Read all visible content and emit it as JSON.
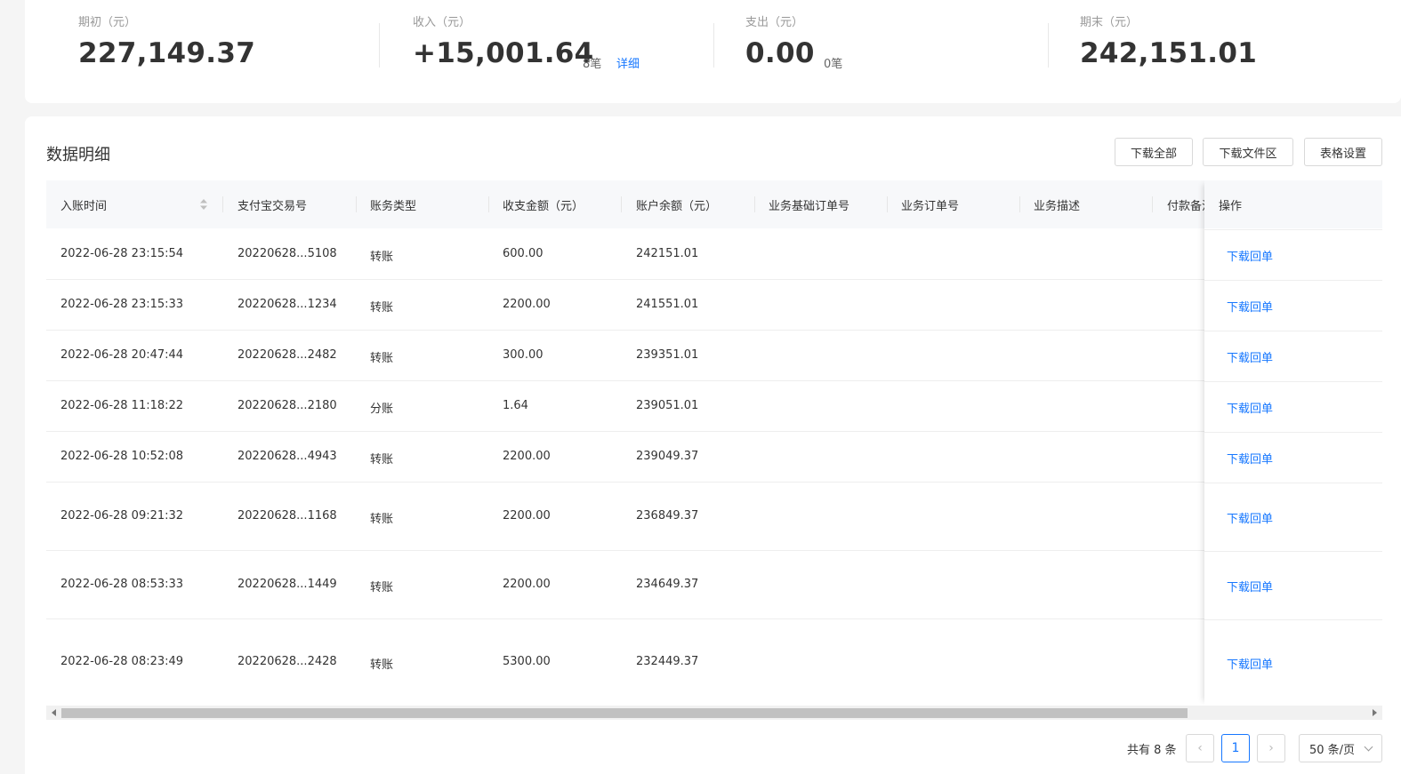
{
  "summary": {
    "opening": {
      "label": "期初（元）",
      "value": "227,149.37"
    },
    "income": {
      "label": "收入（元）",
      "value": "+15,001.64",
      "count": "8笔",
      "detail_link": "详细"
    },
    "expense": {
      "label": "支出（元）",
      "value": "0.00",
      "count": "0笔"
    },
    "closing": {
      "label": "期末（元）",
      "value": "242,151.01"
    }
  },
  "section_title": "数据明细",
  "toolbar": {
    "download_all": "下载全部",
    "download_files": "下载文件区",
    "table_settings": "表格设置"
  },
  "columns": [
    "入账时间",
    "支付宝交易号",
    "账务类型",
    "收支金额（元）",
    "账户余额（元）",
    "业务基础订单号",
    "业务订单号",
    "业务描述",
    "付款备注"
  ],
  "action_column": "操作",
  "rows": [
    {
      "time": "2022-06-28 23:15:54",
      "trade_no": "20220628...5108",
      "type": "转账",
      "amount": "600.00",
      "balance": "242151.01",
      "action": "下载回单"
    },
    {
      "time": "2022-06-28 23:15:33",
      "trade_no": "20220628...1234",
      "type": "转账",
      "amount": "2200.00",
      "balance": "241551.01",
      "action": "下载回单"
    },
    {
      "time": "2022-06-28 20:47:44",
      "trade_no": "20220628...2482",
      "type": "转账",
      "amount": "300.00",
      "balance": "239351.01",
      "action": "下载回单"
    },
    {
      "time": "2022-06-28 11:18:22",
      "trade_no": "20220628...2180",
      "type": "分账",
      "amount": "1.64",
      "balance": "239051.01",
      "action": "下载回单"
    },
    {
      "time": "2022-06-28 10:52:08",
      "trade_no": "20220628...4943",
      "type": "转账",
      "amount": "2200.00",
      "balance": "239049.37",
      "action": "下载回单"
    },
    {
      "time": "2022-06-28 09:21:32",
      "trade_no": "20220628...1168",
      "type": "转账",
      "amount": "2200.00",
      "balance": "236849.37",
      "action": "下载回单"
    },
    {
      "time": "2022-06-28 08:53:33",
      "trade_no": "20220628...1449",
      "type": "转账",
      "amount": "2200.00",
      "balance": "234649.37",
      "action": "下载回单"
    },
    {
      "time": "2022-06-28 08:23:49",
      "trade_no": "20220628...2428",
      "type": "转账",
      "amount": "5300.00",
      "balance": "232449.37",
      "action": "下载回单"
    }
  ],
  "pagination": {
    "total": "共有 8 条",
    "current_page": "1",
    "page_size": "50 条/页"
  },
  "colors": {
    "link": "#1677ff",
    "header_bg": "#f7f8fa"
  }
}
